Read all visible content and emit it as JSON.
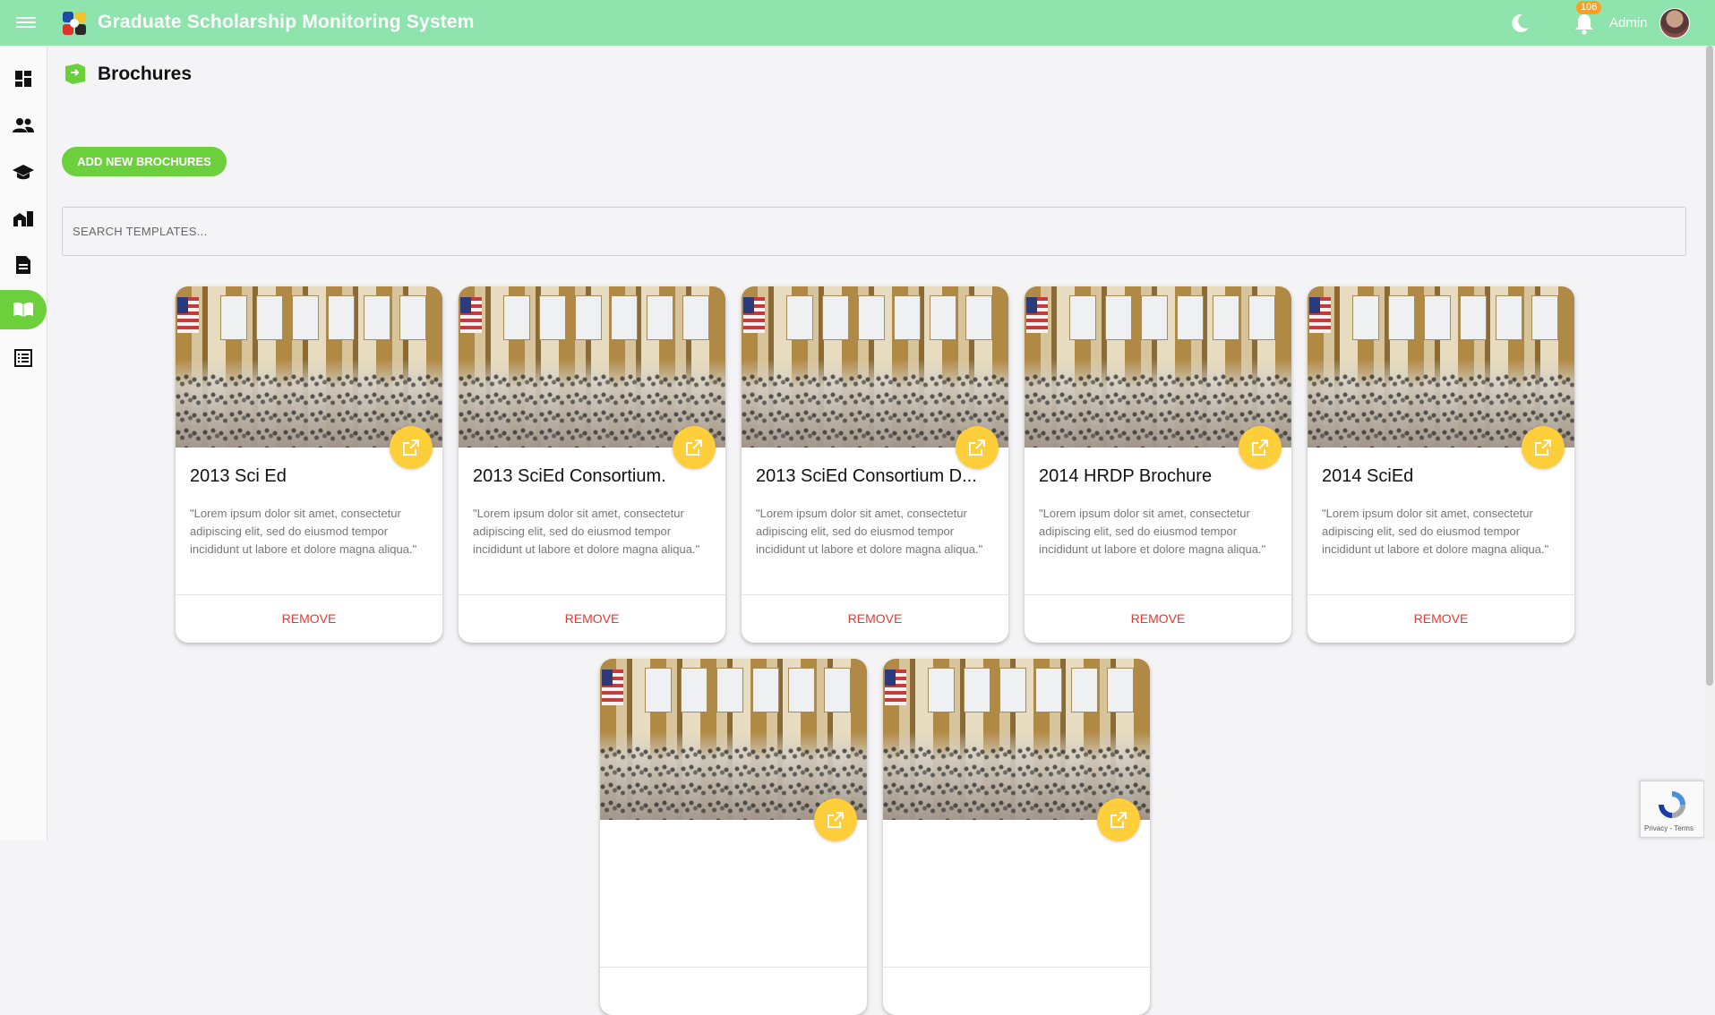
{
  "app": {
    "title": "Graduate Scholarship Monitoring System",
    "notification_count": "106",
    "user_label": "Admin",
    "colors": {
      "topbar": "#8fe3ad",
      "accent": "#6bd03c",
      "open_button": "#ffce3b",
      "remove": "#e53935"
    }
  },
  "sidebar": {
    "items": [
      {
        "name": "dashboard-icon"
      },
      {
        "name": "users-icon"
      },
      {
        "name": "graduation-cap-icon"
      },
      {
        "name": "institution-icon"
      },
      {
        "name": "document-icon"
      },
      {
        "name": "book-icon",
        "active": true
      },
      {
        "name": "list-icon"
      }
    ]
  },
  "page": {
    "title": "Brochures",
    "add_button_label": "ADD NEW BROCHURES",
    "search_placeholder": "SEARCH TEMPLATES..."
  },
  "cards": [
    {
      "title": "2013 Sci Ed",
      "description": "\"Lorem ipsum dolor sit amet, consectetur adipiscing elit, sed do eiusmod tempor incididunt ut labore et dolore magna aliqua.\"",
      "remove_label": "REMOVE"
    },
    {
      "title": "2013 SciEd Consortium.",
      "description": "\"Lorem ipsum dolor sit amet, consectetur adipiscing elit, sed do eiusmod tempor incididunt ut labore et dolore magna aliqua.\"",
      "remove_label": "REMOVE"
    },
    {
      "title": "2013 SciEd Consortium D...",
      "description": "\"Lorem ipsum dolor sit amet, consectetur adipiscing elit, sed do eiusmod tempor incididunt ut labore et dolore magna aliqua.\"",
      "remove_label": "REMOVE"
    },
    {
      "title": "2014 HRDP Brochure",
      "description": "\"Lorem ipsum dolor sit amet, consectetur adipiscing elit, sed do eiusmod tempor incididunt ut labore et dolore magna aliqua.\"",
      "remove_label": "REMOVE"
    },
    {
      "title": "2014 SciEd",
      "description": "\"Lorem ipsum dolor sit amet, consectetur adipiscing elit, sed do eiusmod tempor incididunt ut labore et dolore magna aliqua.\"",
      "remove_label": "REMOVE"
    },
    {
      "title": "",
      "description": "",
      "remove_label": ""
    },
    {
      "title": "",
      "description": "",
      "remove_label": ""
    }
  ],
  "recaptcha": {
    "text": "Privacy - Terms"
  }
}
